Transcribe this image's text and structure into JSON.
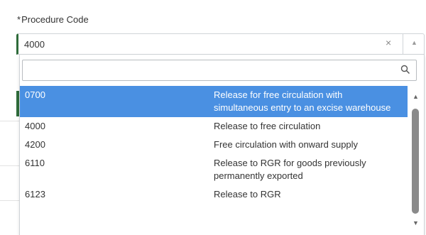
{
  "field": {
    "required_mark": "*",
    "label": "Procedure Code",
    "value": "4000",
    "clear_glyph": "×",
    "arrow_glyph": "▲"
  },
  "search": {
    "placeholder": "",
    "value": ""
  },
  "options": [
    {
      "code": "0700",
      "description": "Release for free circulation with simultaneous entry to an excise warehouse",
      "selected": true
    },
    {
      "code": "4000",
      "description": "Release to free circulation",
      "selected": false
    },
    {
      "code": "4200",
      "description": "Free circulation with onward supply",
      "selected": false
    },
    {
      "code": "6110",
      "description": "Release to RGR for goods previously permanently exported",
      "selected": false
    },
    {
      "code": "6123",
      "description": "Release to RGR",
      "selected": false
    }
  ],
  "scrollbar": {
    "up_glyph": "▲",
    "down_glyph": "▼"
  },
  "colors": {
    "selected_bg": "#4a90e2",
    "accent_border": "#2e6b3a"
  }
}
